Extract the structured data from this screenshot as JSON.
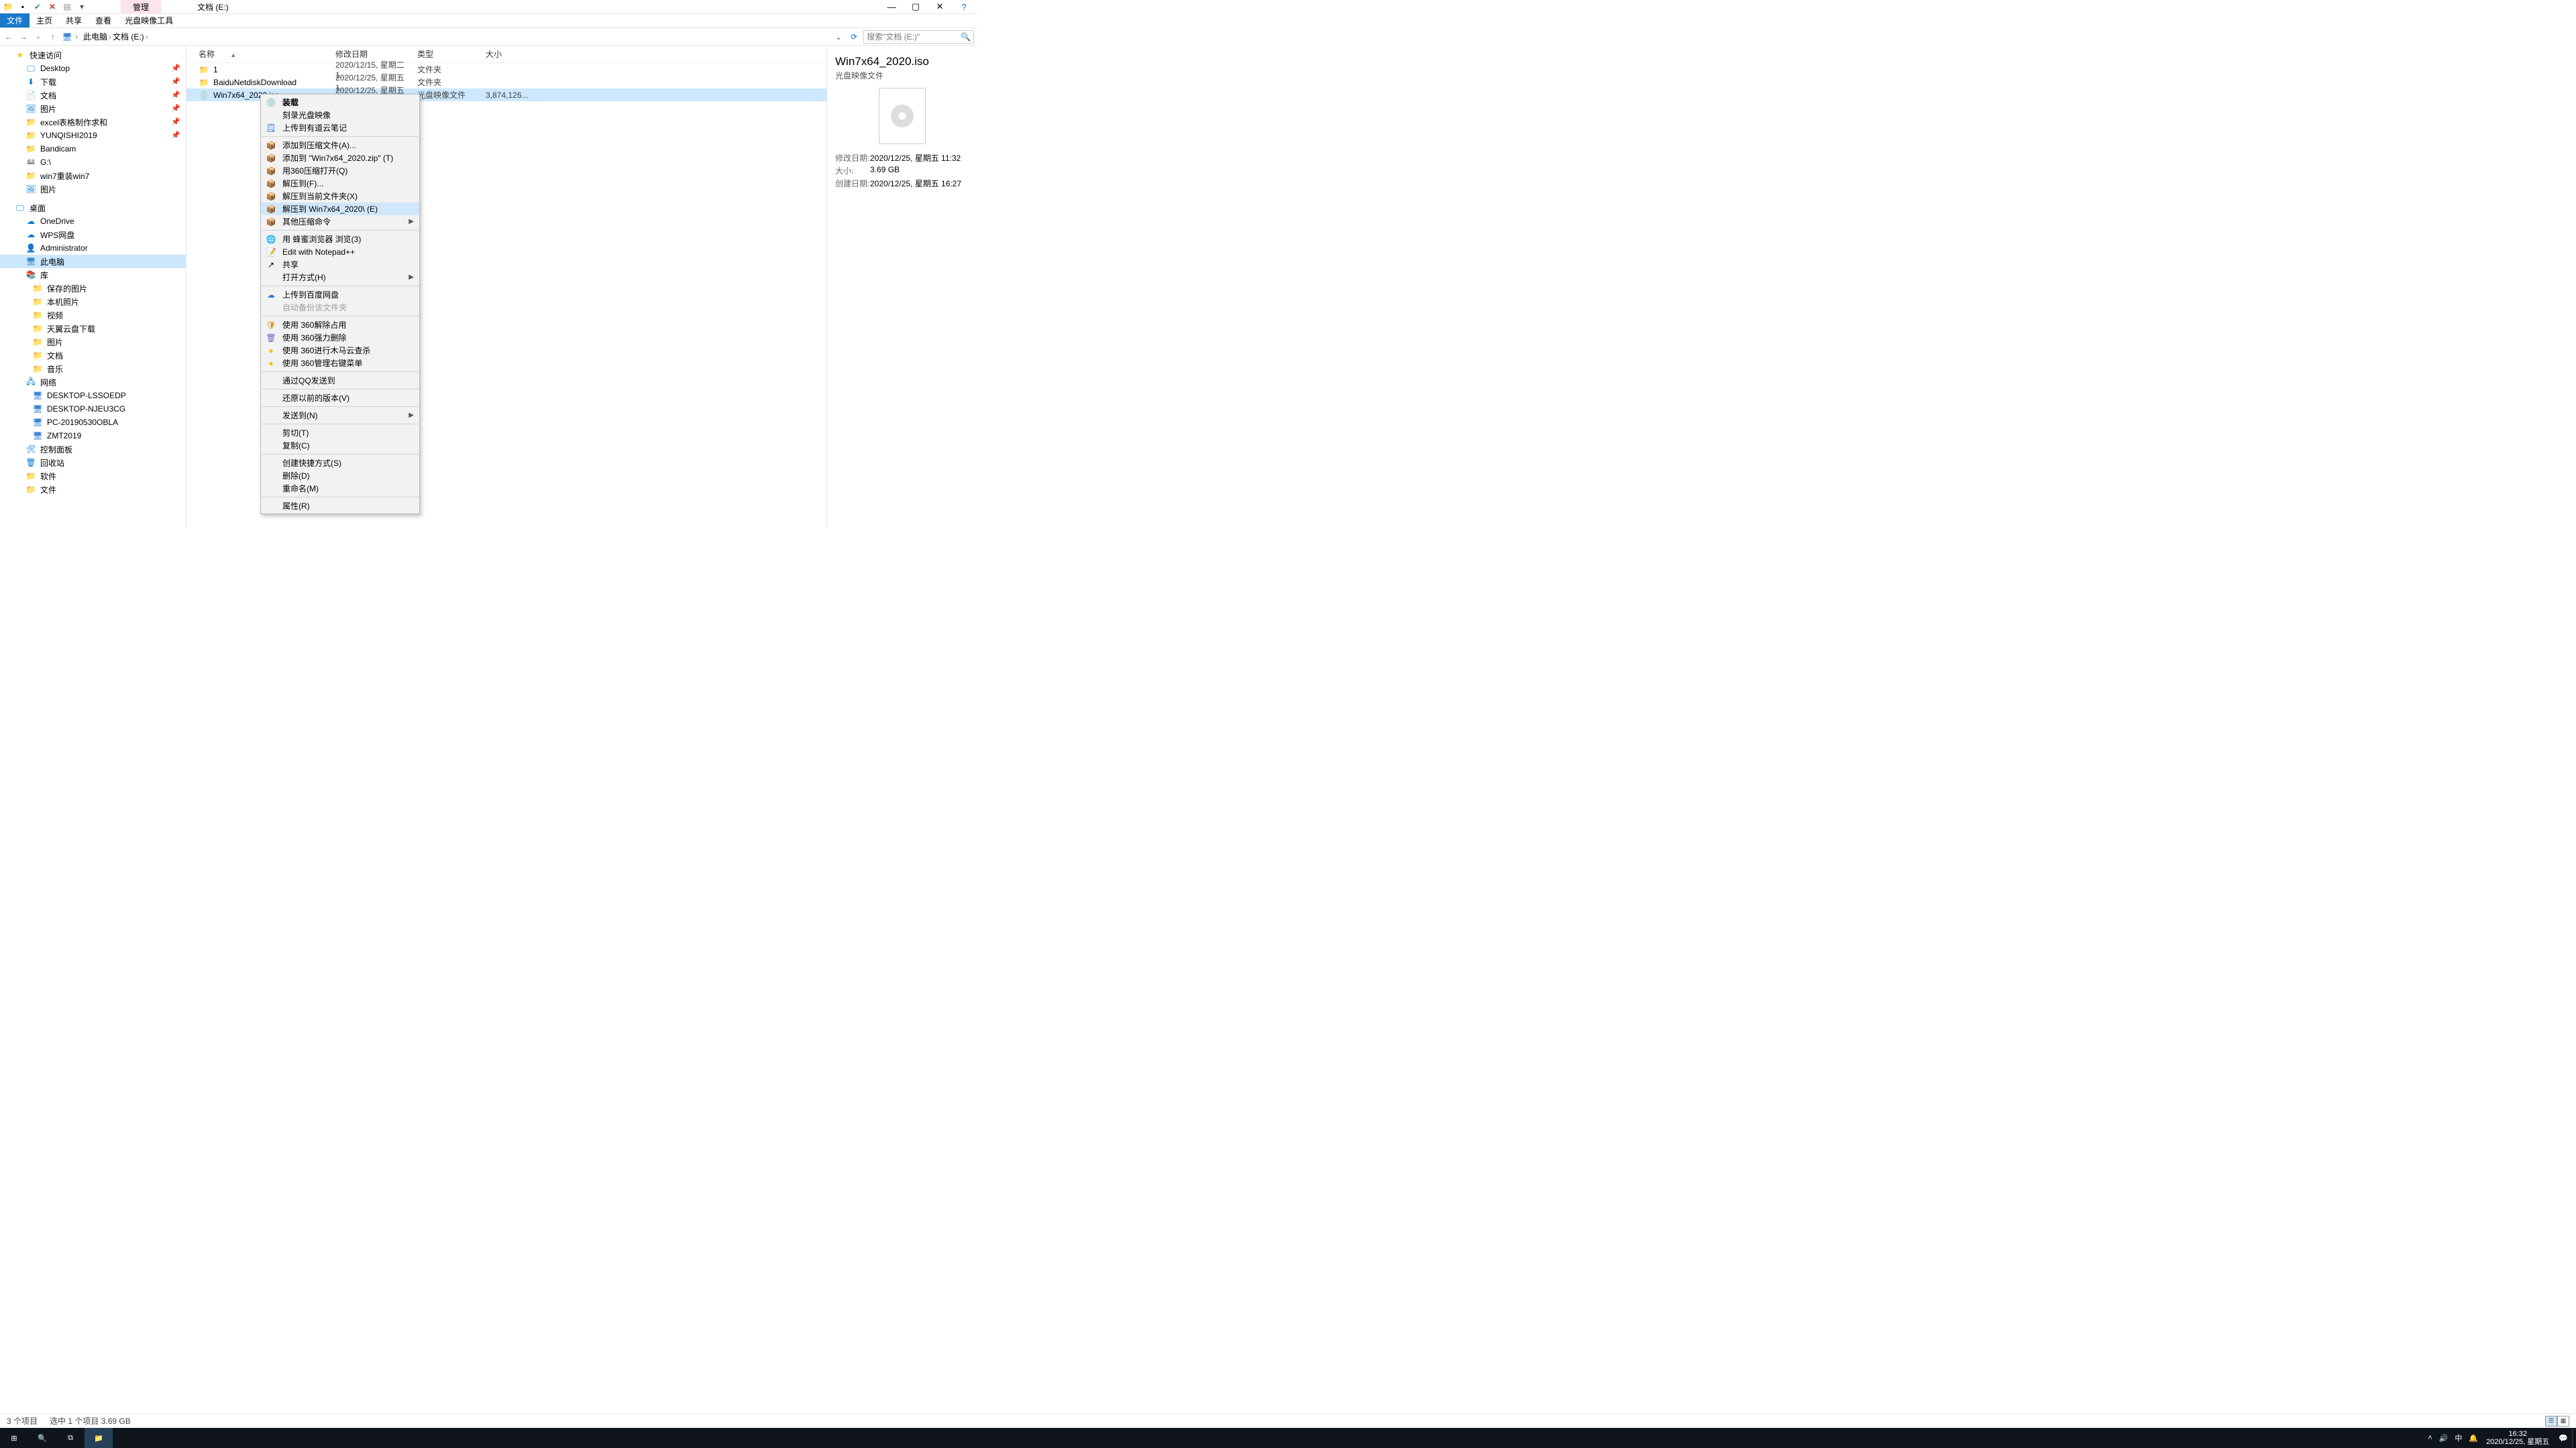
{
  "window": {
    "doc_title": "文档 (E:)",
    "pink_tab": "管理",
    "ribbon_tabs": [
      "文件",
      "主页",
      "共享",
      "查看",
      "光盘映像工具"
    ],
    "win_btns": {
      "min": "—",
      "max": "▢",
      "close": "✕",
      "help": "?"
    }
  },
  "nav": {
    "back": "←",
    "fwd": "→",
    "up": "↑",
    "crumbs": [
      "此电脑",
      "文档 (E:)"
    ],
    "dropdown": "⌄",
    "refresh": "⟳",
    "search_placeholder": "搜索\"文档 (E:)\"",
    "search_icon": "🔍"
  },
  "columns": {
    "name": "名称",
    "date": "修改日期",
    "type": "类型",
    "size": "大小",
    "sort": "▲"
  },
  "rows": [
    {
      "icon": "📁",
      "name": "1",
      "date": "2020/12/15, 星期二 1...",
      "type": "文件夹",
      "size": ""
    },
    {
      "icon": "📁",
      "name": "BaiduNetdiskDownload",
      "date": "2020/12/25, 星期五 1...",
      "type": "文件夹",
      "size": ""
    },
    {
      "icon": "💿",
      "name": "Win7x64_2020.iso",
      "date": "2020/12/25, 星期五 1...",
      "type": "光盘映像文件",
      "size": "3,874,126...",
      "sel": true
    }
  ],
  "tree": [
    {
      "d": 1,
      "ic": "★",
      "cls": "star-ic",
      "t": "快速访问"
    },
    {
      "d": 2,
      "ic": "🖵",
      "cls": "blue-ic",
      "t": "Desktop",
      "pin": true
    },
    {
      "d": 2,
      "ic": "⬇",
      "cls": "blue-ic",
      "t": "下载",
      "pin": true
    },
    {
      "d": 2,
      "ic": "📄",
      "cls": "blue-ic",
      "t": "文档",
      "pin": true
    },
    {
      "d": 2,
      "ic": "🖼",
      "cls": "blue-ic",
      "t": "图片",
      "pin": true
    },
    {
      "d": 2,
      "ic": "📁",
      "cls": "folder-ic",
      "t": "excel表格制作求和",
      "pin": true
    },
    {
      "d": 2,
      "ic": "📁",
      "cls": "folder-ic",
      "t": "YUNQISHI2019",
      "pin": true
    },
    {
      "d": 2,
      "ic": "📁",
      "cls": "folder-ic",
      "t": "Bandicam"
    },
    {
      "d": 2,
      "ic": "🖴",
      "cls": "drive-ic",
      "t": "G:\\"
    },
    {
      "d": 2,
      "ic": "📁",
      "cls": "folder-ic",
      "t": "win7重装win7"
    },
    {
      "d": 2,
      "ic": "🖼",
      "cls": "blue-ic",
      "t": "图片"
    },
    {
      "sep": true
    },
    {
      "d": 1,
      "ic": "🖵",
      "cls": "blue-ic",
      "t": "桌面"
    },
    {
      "d": 2,
      "ic": "☁",
      "cls": "blue-ic",
      "t": "OneDrive"
    },
    {
      "d": 2,
      "ic": "☁",
      "cls": "blue-ic",
      "t": "WPS网盘"
    },
    {
      "d": 2,
      "ic": "👤",
      "cls": "blue-ic",
      "t": "Administrator"
    },
    {
      "d": 2,
      "ic": "🖥",
      "cls": "mon-ic",
      "t": "此电脑",
      "sel": true
    },
    {
      "d": 2,
      "ic": "📚",
      "cls": "blue-ic",
      "t": "库"
    },
    {
      "d": 2,
      "ic": "📁",
      "cls": "folder-ic",
      "t": "  保存的图片",
      "d3": true
    },
    {
      "d": 2,
      "ic": "📁",
      "cls": "folder-ic",
      "t": "  本机照片",
      "d3": true
    },
    {
      "d": 2,
      "ic": "📁",
      "cls": "folder-ic",
      "t": "  视频",
      "d3": true
    },
    {
      "d": 2,
      "ic": "📁",
      "cls": "folder-ic",
      "t": "  天翼云盘下载",
      "d3": true
    },
    {
      "d": 2,
      "ic": "📁",
      "cls": "folder-ic",
      "t": "  图片",
      "d3": true
    },
    {
      "d": 2,
      "ic": "📁",
      "cls": "folder-ic",
      "t": "  文档",
      "d3": true
    },
    {
      "d": 2,
      "ic": "📁",
      "cls": "folder-ic",
      "t": "  音乐",
      "d3": true
    },
    {
      "d": 2,
      "ic": "🖧",
      "cls": "blue-ic",
      "t": "网络"
    },
    {
      "d": 2,
      "ic": "🖥",
      "cls": "mon-ic",
      "t": "  DESKTOP-LSSOEDP",
      "d3": true
    },
    {
      "d": 2,
      "ic": "🖥",
      "cls": "mon-ic",
      "t": "  DESKTOP-NJEU3CG",
      "d3": true
    },
    {
      "d": 2,
      "ic": "🖥",
      "cls": "mon-ic",
      "t": "  PC-20190530OBLA",
      "d3": true
    },
    {
      "d": 2,
      "ic": "🖥",
      "cls": "mon-ic",
      "t": "  ZMT2019",
      "d3": true
    },
    {
      "d": 2,
      "ic": "🛠",
      "cls": "blue-ic",
      "t": "控制面板"
    },
    {
      "d": 2,
      "ic": "🗑",
      "cls": "blue-ic",
      "t": "回收站"
    },
    {
      "d": 2,
      "ic": "📁",
      "cls": "folder-ic",
      "t": "软件"
    },
    {
      "d": 2,
      "ic": "📁",
      "cls": "folder-ic",
      "t": "文件"
    }
  ],
  "details": {
    "title": "Win7x64_2020.iso",
    "subtitle": "光盘映像文件",
    "rows": [
      {
        "k": "修改日期:",
        "v": "2020/12/25, 星期五 11:32"
      },
      {
        "k": "大小:",
        "v": "3.69 GB"
      },
      {
        "k": "创建日期:",
        "v": "2020/12/25, 星期五 16:27"
      }
    ]
  },
  "status": {
    "count": "3 个项目",
    "sel": "选中 1 个项目  3.69 GB"
  },
  "ctx": [
    {
      "ic": "💿",
      "t": "装载",
      "bold": true
    },
    {
      "ic": "",
      "t": "刻录光盘映像"
    },
    {
      "ic": "🗒",
      "t": "上传到有道云笔记",
      "iccol": "#2f7bde"
    },
    {
      "hr": true
    },
    {
      "ic": "📦",
      "t": "添加到压缩文件(A)..."
    },
    {
      "ic": "📦",
      "t": "添加到 \"Win7x64_2020.zip\" (T)"
    },
    {
      "ic": "📦",
      "t": "用360压缩打开(Q)"
    },
    {
      "ic": "📦",
      "t": "解压到(F)..."
    },
    {
      "ic": "📦",
      "t": "解压到当前文件夹(X)"
    },
    {
      "ic": "📦",
      "t": "解压到 Win7x64_2020\\ (E)",
      "hover": true
    },
    {
      "ic": "📦",
      "t": "其他压缩命令",
      "arrow": true
    },
    {
      "hr": true
    },
    {
      "ic": "🌐",
      "t": "用 蜂蜜浏览器 浏览(3)",
      "iccol": "#47b04b"
    },
    {
      "ic": "📝",
      "t": "Edit with Notepad++",
      "iccol": "#47b04b"
    },
    {
      "ic": "↗",
      "t": "共享"
    },
    {
      "ic": "",
      "t": "打开方式(H)",
      "arrow": true
    },
    {
      "hr": true
    },
    {
      "ic": "☁",
      "t": "上传到百度网盘",
      "iccol": "#2f7bde"
    },
    {
      "ic": "",
      "t": "自动备份该文件夹",
      "disabled": true
    },
    {
      "hr": true
    },
    {
      "ic": "🛡",
      "t": "使用 360解除占用",
      "iccol": "#d88b00"
    },
    {
      "ic": "🗑",
      "t": "使用 360强力删除",
      "iccol": "#7a5cc8"
    },
    {
      "ic": "●",
      "t": "使用 360进行木马云查杀",
      "iccol": "#f3c100"
    },
    {
      "ic": "●",
      "t": "使用 360管理右键菜单",
      "iccol": "#f3c100"
    },
    {
      "hr": true
    },
    {
      "ic": "",
      "t": "通过QQ发送到"
    },
    {
      "hr": true
    },
    {
      "ic": "",
      "t": "还原以前的版本(V)"
    },
    {
      "hr": true
    },
    {
      "ic": "",
      "t": "发送到(N)",
      "arrow": true
    },
    {
      "hr": true
    },
    {
      "ic": "",
      "t": "剪切(T)"
    },
    {
      "ic": "",
      "t": "复制(C)"
    },
    {
      "hr": true
    },
    {
      "ic": "",
      "t": "创建快捷方式(S)"
    },
    {
      "ic": "",
      "t": "删除(D)"
    },
    {
      "ic": "",
      "t": "重命名(M)"
    },
    {
      "hr": true
    },
    {
      "ic": "",
      "t": "属性(R)"
    }
  ],
  "taskbar": {
    "items": [
      "⊞",
      "🔍",
      "⧉",
      "📁"
    ],
    "tray": [
      "˄",
      "🔊",
      "中",
      "🔔"
    ],
    "time": "16:32",
    "date": "2020/12/25, 星期五",
    "badge": "💬"
  }
}
